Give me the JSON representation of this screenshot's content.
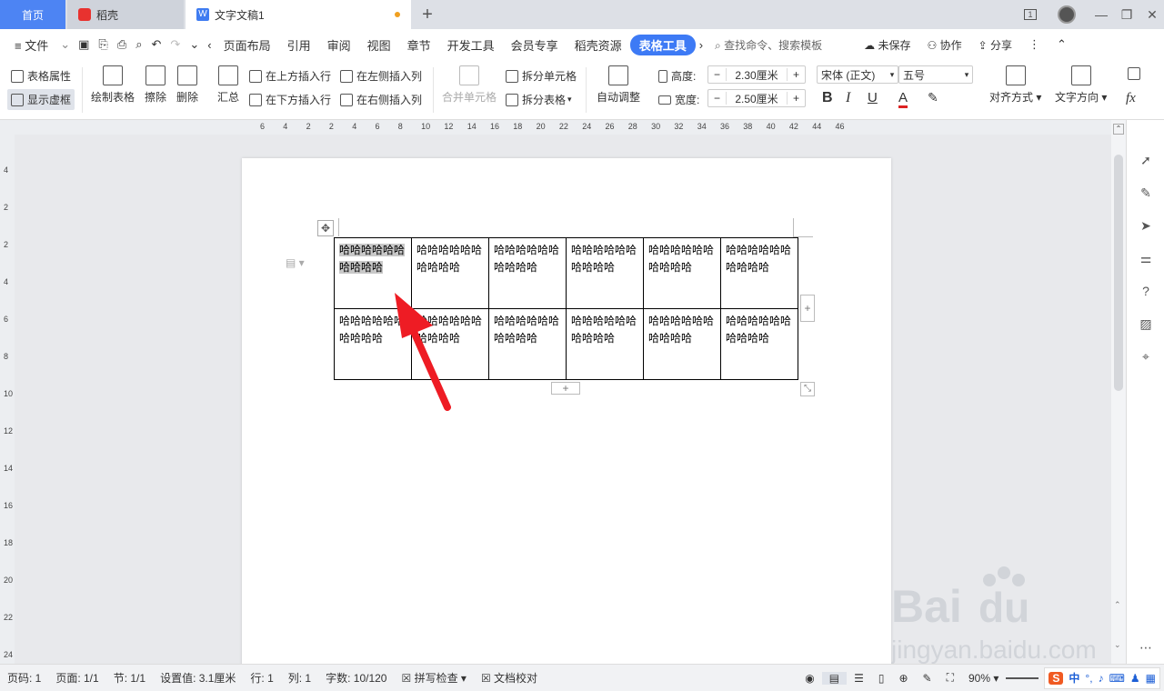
{
  "tabs": {
    "home": "首页",
    "daoke": "稻壳",
    "doc": "文字文稿1",
    "new": "+"
  },
  "window": {
    "counter": "1",
    "minimize": "—",
    "restore": "❐",
    "close": "✕"
  },
  "menu": {
    "file": "≡ 文件",
    "items": [
      "页面布局",
      "引用",
      "审阅",
      "视图",
      "章节",
      "开发工具",
      "会员专享",
      "稻壳资源"
    ],
    "active": "表格工具",
    "search": "查找命令、搜索模板",
    "unsaved": "未保存",
    "collab": "协作",
    "share": "分享"
  },
  "ribbon": {
    "table_props": "表格属性",
    "show_grid": "显示虚框",
    "draw_table": "绘制表格",
    "erase": "擦除",
    "delete": "删除",
    "summary": "汇总",
    "insert_above": "在上方插入行",
    "insert_below": "在下方插入行",
    "insert_left": "在左侧插入列",
    "insert_right": "在右侧插入列",
    "merge": "合并单元格",
    "split_cell": "拆分单元格",
    "split_table": "拆分表格",
    "auto_adjust": "自动调整",
    "height_label": "高度:",
    "height_value": "2.30厘米",
    "width_label": "宽度:",
    "width_value": "2.50厘米",
    "font": "宋体 (正文)",
    "size": "五号",
    "bold": "B",
    "italic": "I",
    "underline": "U",
    "fontcolor": "A",
    "align": "对齐方式",
    "textdir": "文字方向",
    "fx": "fx"
  },
  "ruler_h": [
    "6",
    "4",
    "2",
    "2",
    "4",
    "6",
    "8",
    "10",
    "12",
    "14",
    "16",
    "18",
    "20",
    "22",
    "24",
    "26",
    "28",
    "30",
    "32",
    "34",
    "36",
    "38",
    "40",
    "42",
    "44",
    "46"
  ],
  "ruler_v": [
    "4",
    "2",
    "2",
    "4",
    "6",
    "8",
    "10",
    "12",
    "14",
    "16",
    "18",
    "20",
    "22",
    "24"
  ],
  "table": {
    "rows": [
      [
        "哈哈哈哈哈哈哈哈哈哈",
        "哈哈哈哈哈哈哈哈哈哈",
        "哈哈哈哈哈哈哈哈哈哈",
        "哈哈哈哈哈哈哈哈哈哈",
        "哈哈哈哈哈哈哈哈哈哈",
        "哈哈哈哈哈哈哈哈哈哈"
      ],
      [
        "哈哈哈哈哈哈哈哈哈哈",
        "哈哈哈哈哈哈哈哈哈哈",
        "哈哈哈哈哈哈哈哈哈哈",
        "哈哈哈哈哈哈哈哈哈哈",
        "哈哈哈哈哈哈哈哈哈哈",
        "哈哈哈哈哈哈哈哈哈哈"
      ]
    ]
  },
  "status": {
    "page": "页码: 1",
    "pages": "页面: 1/1",
    "section": "节: 1/1",
    "setting": "设置值: 3.1厘米",
    "row": "行: 1",
    "col": "列: 1",
    "words": "字数: 10/120",
    "spell": "拼写检查",
    "proof": "文档校对",
    "zoom": "90%"
  },
  "ime": {
    "logo": "S",
    "lang": "中"
  },
  "colors": {
    "accent": "#3d7af5",
    "home_tab": "#4d84f3",
    "arrow": "#ee1c24"
  }
}
